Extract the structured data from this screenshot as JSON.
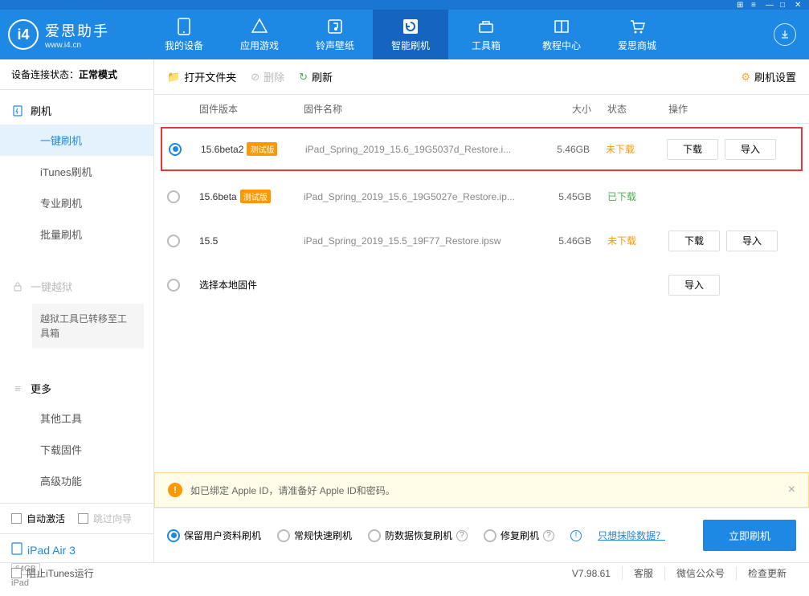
{
  "titlebar": {
    "icons": [
      "⊞",
      "≡",
      "—",
      "□",
      "✕"
    ]
  },
  "header": {
    "logo_name": "爱思助手",
    "logo_url": "www.i4.cn",
    "nav": [
      {
        "label": "我的设备"
      },
      {
        "label": "应用游戏"
      },
      {
        "label": "铃声壁纸"
      },
      {
        "label": "智能刷机",
        "active": true
      },
      {
        "label": "工具箱"
      },
      {
        "label": "教程中心"
      },
      {
        "label": "爱思商城"
      }
    ]
  },
  "sidebar": {
    "conn_label": "设备连接状态：",
    "conn_value": "正常模式",
    "flash_head": "刷机",
    "flash_items": [
      "一键刷机",
      "iTunes刷机",
      "专业刷机",
      "批量刷机"
    ],
    "jail_head": "一键越狱",
    "jail_note": "越狱工具已转移至工具箱",
    "more_head": "更多",
    "more_items": [
      "其他工具",
      "下载固件",
      "高级功能"
    ],
    "chk1": "自动激活",
    "chk2": "跳过向导",
    "device_name": "iPad Air 3",
    "device_cap": "64GB",
    "device_type": "iPad"
  },
  "toolbar": {
    "open": "打开文件夹",
    "delete": "删除",
    "refresh": "刷新",
    "settings": "刷机设置"
  },
  "table": {
    "h_version": "固件版本",
    "h_name": "固件名称",
    "h_size": "大小",
    "h_status": "状态",
    "h_ops": "操作",
    "rows": [
      {
        "selected": true,
        "version": "15.6beta2",
        "beta": "测试版",
        "name": "iPad_Spring_2019_15.6_19G5037d_Restore.i...",
        "size": "5.46GB",
        "status": "未下载",
        "status_cls": "no",
        "download": "下载",
        "import": "导入",
        "highlighted": true
      },
      {
        "selected": false,
        "version": "15.6beta",
        "beta": "测试版",
        "name": "iPad_Spring_2019_15.6_19G5027e_Restore.ip...",
        "size": "5.45GB",
        "status": "已下载",
        "status_cls": "yes"
      },
      {
        "selected": false,
        "version": "15.5",
        "name": "iPad_Spring_2019_15.5_19F77_Restore.ipsw",
        "size": "5.46GB",
        "status": "未下载",
        "status_cls": "no",
        "download": "下载",
        "import": "导入"
      },
      {
        "selected": false,
        "local": "选择本地固件",
        "import": "导入"
      }
    ]
  },
  "notice": "如已绑定 Apple ID，请准备好 Apple ID和密码。",
  "options": {
    "opt1": "保留用户资料刷机",
    "opt2": "常规快速刷机",
    "opt3": "防数据恢复刷机",
    "opt4": "修复刷机",
    "link": "只想抹除数据？",
    "flash": "立即刷机"
  },
  "statusbar": {
    "block": "阻止iTunes运行",
    "version": "V7.98.61",
    "s1": "客服",
    "s2": "微信公众号",
    "s3": "检查更新"
  }
}
